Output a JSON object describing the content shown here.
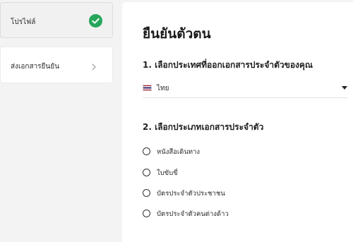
{
  "sidebar": {
    "items": [
      {
        "label": "โปรไฟล์",
        "status": "completed",
        "icon": "check-circle-icon",
        "status_color": "#26a65b"
      },
      {
        "label": "ส่งเอกสารยืนยัน",
        "icon": "chevron-right-icon"
      }
    ]
  },
  "main": {
    "title": "ยืนยันตัวตน",
    "country_section": {
      "heading": "1. เลือกประเทศที่ออกเอกสารประจำตัวของคุณ",
      "selected_country": "ไทย",
      "flag_icon": "thailand-flag-icon"
    },
    "document_section": {
      "heading": "2. เลือกประเภทเอกสารประจำตัว",
      "options": [
        {
          "label": "หนังสือเดินทาง"
        },
        {
          "label": "ใบขับขี่"
        },
        {
          "label": "บัตรประจำตัวประชาชน"
        },
        {
          "label": "บัตรประจำตัวคนต่างด้าว"
        }
      ]
    }
  }
}
